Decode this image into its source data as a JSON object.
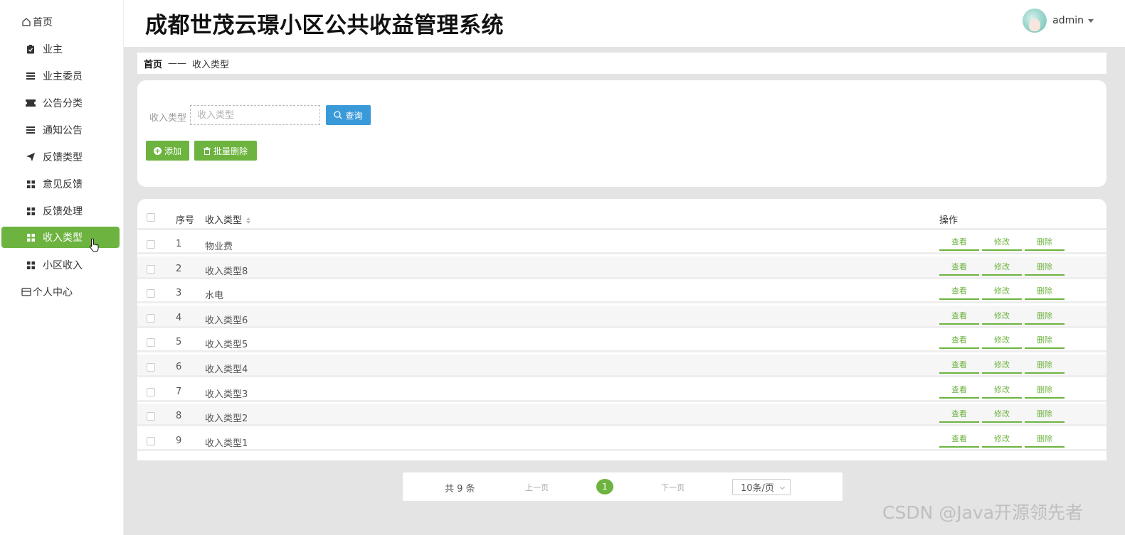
{
  "app": {
    "title": "成都世茂云璟小区公共收益管理系统"
  },
  "user": {
    "name": "admin"
  },
  "sidebar": {
    "items": [
      {
        "label": "首页",
        "icon": "home-icon"
      },
      {
        "label": "业主",
        "icon": "clipboard-icon"
      },
      {
        "label": "业主委员",
        "icon": "list-icon"
      },
      {
        "label": "公告分类",
        "icon": "ticket-icon"
      },
      {
        "label": "通知公告",
        "icon": "list-icon"
      },
      {
        "label": "反馈类型",
        "icon": "send-icon"
      },
      {
        "label": "意见反馈",
        "icon": "grid-icon"
      },
      {
        "label": "反馈处理",
        "icon": "grid-icon"
      },
      {
        "label": "收入类型",
        "icon": "grid-icon",
        "active": true
      },
      {
        "label": "小区收入",
        "icon": "grid-icon"
      },
      {
        "label": "个人中心",
        "icon": "card-icon"
      }
    ]
  },
  "breadcrumb": {
    "home": "首页",
    "separator": "——",
    "current": "收入类型"
  },
  "search": {
    "label": "收入类型",
    "placeholder": "收入类型",
    "query_label": "查询"
  },
  "actions": {
    "add_label": "添加",
    "batch_delete_label": "批量删除"
  },
  "table": {
    "headers": {
      "index": "序号",
      "type": "收入类型",
      "ops": "操作"
    },
    "op_labels": {
      "view": "查看",
      "edit": "修改",
      "delete": "删除"
    },
    "rows": [
      {
        "index": "1",
        "name": "物业费"
      },
      {
        "index": "2",
        "name": "收入类型8"
      },
      {
        "index": "3",
        "name": "水电"
      },
      {
        "index": "4",
        "name": "收入类型6"
      },
      {
        "index": "5",
        "name": "收入类型5"
      },
      {
        "index": "6",
        "name": "收入类型4"
      },
      {
        "index": "7",
        "name": "收入类型3"
      },
      {
        "index": "8",
        "name": "收入类型2"
      },
      {
        "index": "9",
        "name": "收入类型1"
      }
    ]
  },
  "pagination": {
    "total": "共 9 条",
    "prev": "上一页",
    "current": "1",
    "next": "下一页",
    "page_size": "10条/页"
  },
  "watermark": "CSDN @Java开源领先者",
  "colors": {
    "accent": "#6db33f",
    "query": "#3a9ad9"
  }
}
